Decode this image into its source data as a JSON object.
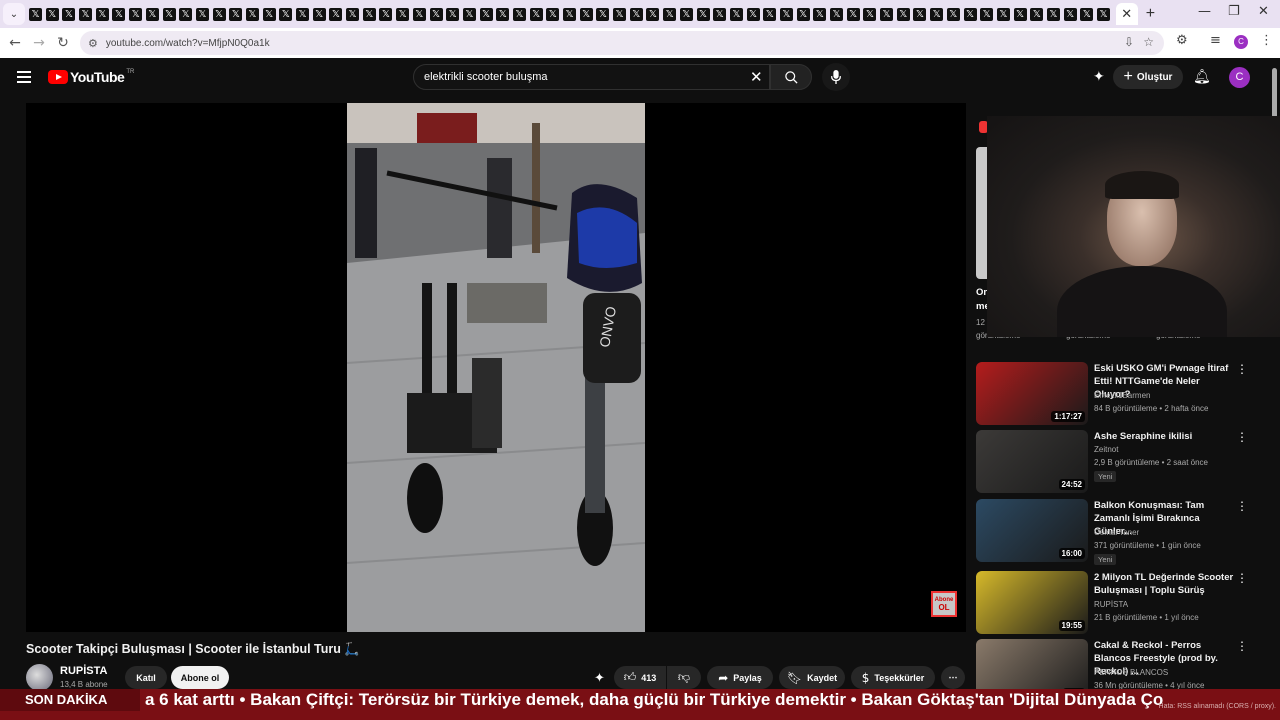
{
  "browser": {
    "tab_count": 65,
    "tab_glyph": "𝕏",
    "active_tab_close": "✕",
    "new_tab": "+",
    "url": "youtube.com/watch?v=MfjpN0Q0a1k",
    "profile_initial": "C"
  },
  "youtube": {
    "logo_text": "YouTube",
    "country_code": "TR",
    "search_query": "elektrikli scooter buluşma",
    "create_label": "Oluştur",
    "avatar_initial": "C",
    "accent_color": "#ff0000"
  },
  "video": {
    "title": "Scooter Takipçi Buluşması | Scooter ile İstanbul Turu 🛴",
    "watermark_line1": "Abone",
    "watermark_line2": "OL",
    "channel": "RUPİSTA",
    "subscribers": "13,4 B abone",
    "join_label": "Katıl",
    "subscribe_label": "Abone ol",
    "like_count": "413",
    "share_label": "Paylaş",
    "save_label": "Kaydet",
    "thanks_label": "Teşekkürler"
  },
  "sidebar": {
    "partial_top": {
      "title_line1": "On",
      "title_line2": "me",
      "meta_prefix": "12",
      "views_label": "görüntüleme"
    },
    "items": [
      {
        "title": "Eski USKO GM'i Pwnage İtiraf Etti! NTTGame'de Neler Oluyor?",
        "channel": "Emekli1Barmen",
        "stats": "84 B görüntüleme • 2 hafta önce",
        "duration": "1:17:27",
        "badge": "",
        "thumb_color": "#b51c1c"
      },
      {
        "title": "Ashe Seraphine ikilisi",
        "channel": "Zeitnot",
        "stats": "2,9 B görüntüleme • 2 saat önce",
        "duration": "24:52",
        "badge": "Yeni",
        "thumb_color": "#3c3a38"
      },
      {
        "title": "Balkon Konuşması: Tam Zamanlı İşimi Bırakınca Günler...",
        "channel": "Cemal Taner",
        "stats": "371 görüntüleme • 1 gün önce",
        "duration": "16:00",
        "badge": "Yeni",
        "thumb_color": "#2c4a63"
      },
      {
        "title": "2 Milyon TL Değerinde Scooter Buluşması | Toplu Sürüş",
        "channel": "RUPİSTA",
        "stats": "21 B görüntüleme • 1 yıl önce",
        "duration": "19:55",
        "badge": "",
        "thumb_color": "#d6b92a"
      },
      {
        "title": "Cakal & Reckol - Perros Blancos Freestyle (prod by. Reckol) ...",
        "channel": "PERROS BLANCOS",
        "stats": "36 Mn görüntüleme • 4 yıl önce",
        "duration": "3:24",
        "badge": "",
        "thumb_color": "#8a7a6a"
      }
    ]
  },
  "ticker": {
    "label": "SON DAKİKA",
    "text": "a 6 kat arttı   •   Bakan Çiftçi: Terörsüz bir Türkiye demek, daha güçlü bir Türkiye demektir   •   Bakan Göktaş'tan 'Dijital Dünyada Ço",
    "note": "Hata: RSS alınamadı (CORS / proxy)."
  }
}
